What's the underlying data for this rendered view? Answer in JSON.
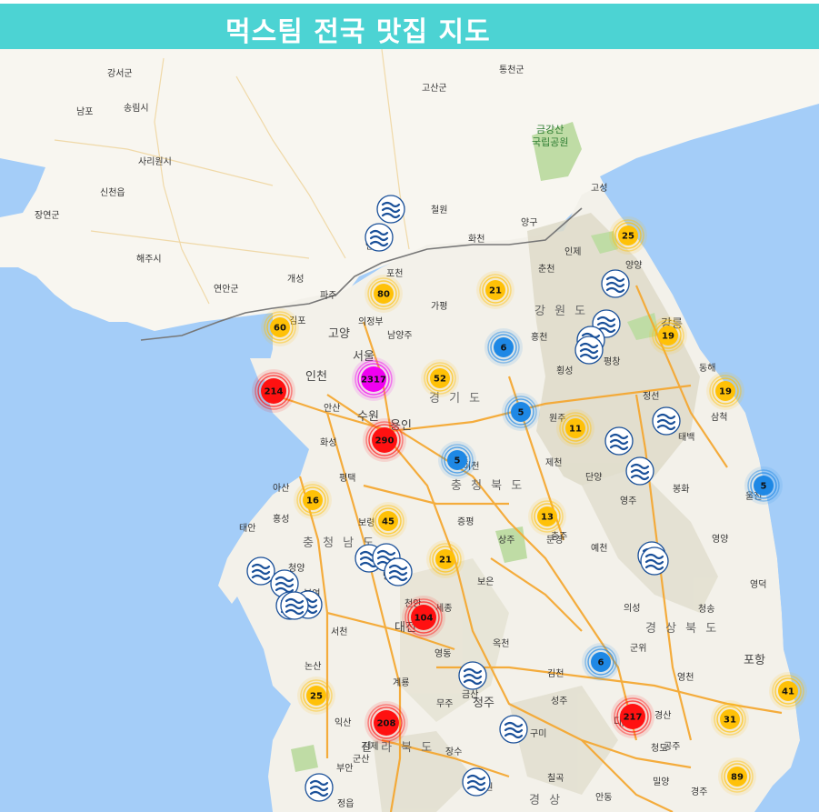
{
  "header": {
    "title": "먹스팀 전국 맛집 지도"
  },
  "colors": {
    "header_bg": "#4cd3d3",
    "sea": "#a4cdf8",
    "land": "#f3f1ea",
    "north_land": "#f8f6f0",
    "mountain": "#dedbc9",
    "forest": "#bfdca5",
    "highway": "#f5a52a",
    "cluster_red": "#ff1111",
    "cluster_magenta": "#f000f0",
    "cluster_yellow": "#ffc107",
    "cluster_blue": "#1e88e5"
  },
  "map": {
    "province_labels": [
      "강 원 도",
      "경 기 도",
      "충 청 북 도",
      "충 청 남 도",
      "경 상 북 도",
      "전 라 북 도",
      "경 상"
    ],
    "park_labels": [
      "금강산",
      "국립공원"
    ],
    "city_labels": [
      "강서군",
      "남포",
      "송림시",
      "고산군",
      "통천군",
      "사리원시",
      "신천읍",
      "장연군",
      "고성",
      "철원",
      "화천",
      "양구",
      "인제",
      "해주시",
      "개성",
      "연안군",
      "파주",
      "포천",
      "가평",
      "양양",
      "강릉",
      "동해",
      "삼척",
      "태백",
      "정선",
      "평창",
      "횡성",
      "홍천",
      "의정부",
      "남양주",
      "고양",
      "김포",
      "서울",
      "인천",
      "안산",
      "수원",
      "용인",
      "화성",
      "제천",
      "단양",
      "영주",
      "봉화",
      "울진",
      "영양",
      "영덕",
      "청송",
      "의성",
      "군위",
      "포항",
      "영천",
      "경산",
      "청도",
      "밀양",
      "충주",
      "증평",
      "문경",
      "예천",
      "상주",
      "김천",
      "구미",
      "보은",
      "옥천",
      "영동",
      "금산",
      "무주",
      "청주",
      "세종",
      "천안",
      "서산",
      "태안",
      "홍성",
      "청양",
      "부여",
      "서천",
      "논산",
      "익산",
      "군산",
      "김제",
      "부안",
      "정읍",
      "장수",
      "남원",
      "순창",
      "성주",
      "대구",
      "칠곡",
      "안동",
      "대전",
      "계룡",
      "연천",
      "춘천",
      "원주",
      "여주",
      "이천",
      "평택",
      "아산",
      "당진",
      "보령",
      "공주",
      "경주",
      "울산",
      "창녕",
      "합천",
      "거창"
    ],
    "clusters": [
      {
        "count": "2317",
        "color": "magenta"
      },
      {
        "count": "214",
        "color": "red"
      },
      {
        "count": "290",
        "color": "red"
      },
      {
        "count": "104",
        "color": "red"
      },
      {
        "count": "208",
        "color": "red"
      },
      {
        "count": "217",
        "color": "red"
      },
      {
        "count": "60",
        "color": "yellow"
      },
      {
        "count": "80",
        "color": "yellow"
      },
      {
        "count": "21",
        "color": "yellow"
      },
      {
        "count": "25",
        "color": "yellow"
      },
      {
        "count": "19",
        "color": "yellow"
      },
      {
        "count": "19",
        "color": "yellow"
      },
      {
        "count": "52",
        "color": "yellow"
      },
      {
        "count": "11",
        "color": "yellow"
      },
      {
        "count": "16",
        "color": "yellow"
      },
      {
        "count": "45",
        "color": "yellow"
      },
      {
        "count": "13",
        "color": "yellow"
      },
      {
        "count": "21",
        "color": "yellow"
      },
      {
        "count": "25",
        "color": "yellow"
      },
      {
        "count": "31",
        "color": "yellow"
      },
      {
        "count": "41",
        "color": "yellow"
      },
      {
        "count": "89",
        "color": "yellow"
      },
      {
        "count": "6",
        "color": "blue"
      },
      {
        "count": "5",
        "color": "blue"
      },
      {
        "count": "5",
        "color": "blue"
      },
      {
        "count": "5",
        "color": "blue"
      },
      {
        "count": "6",
        "color": "blue"
      }
    ],
    "marker_icon": "steemit-logo-icon"
  }
}
